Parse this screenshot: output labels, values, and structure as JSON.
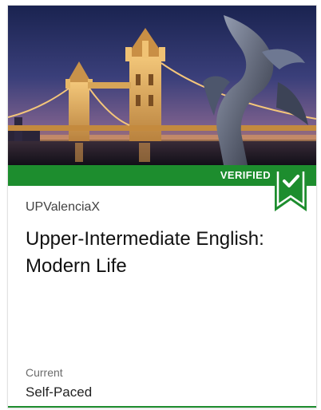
{
  "course_card": {
    "badge_label": "VERIFIED",
    "organization": "UPValenciaX",
    "title": "Upper-Intermediate English: Modern Life",
    "status_label": "Current",
    "pacing": "Self-Paced",
    "image_alt": "Tower Bridge, London at dusk with dolphin statue",
    "colors": {
      "verified_green": "#1d8d2e",
      "ribbon_icon": "checkmark-icon"
    }
  }
}
